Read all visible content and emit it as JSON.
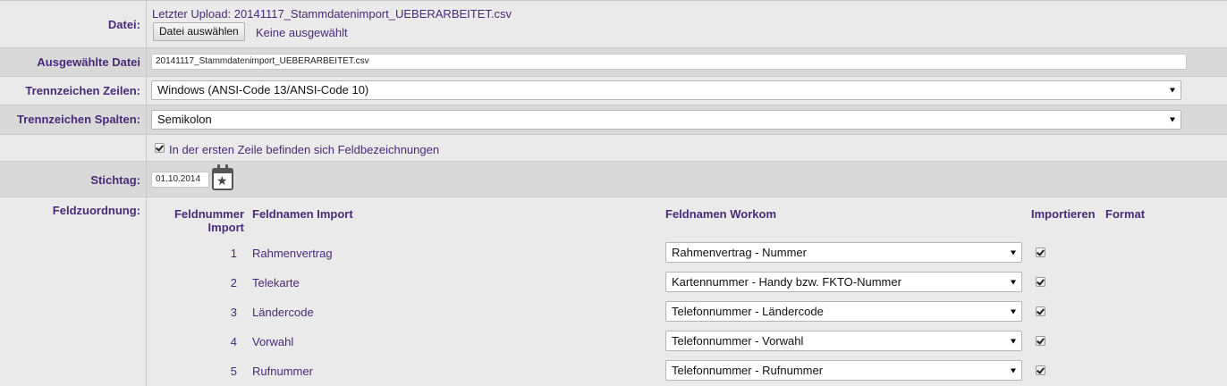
{
  "file": {
    "label": "Datei:",
    "last_upload": "Letzter Upload: 20141117_Stammdatenimport_UEBERARBEITET.csv",
    "button_label": "Datei auswählen",
    "no_file_text": "Keine ausgewählt"
  },
  "selected_file": {
    "label": "Ausgewählte Datei",
    "value": "20141117_Stammdatenimport_UEBERARBEITET.csv"
  },
  "row_delimiter": {
    "label": "Trennzeichen Zeilen:",
    "value": "Windows (ANSI-Code 13/ANSI-Code 10)"
  },
  "column_delimiter": {
    "label": "Trennzeichen Spalten:",
    "value": "Semikolon"
  },
  "header_row": {
    "checked": true,
    "label": "In der ersten Zeile befinden sich Feldbezeichnungen"
  },
  "key_date": {
    "label": "Stichtag:",
    "value": "01.10.2014",
    "calendar_icon": "calendar-star-icon"
  },
  "mapping": {
    "label": "Feldzuordnung:",
    "headers": {
      "number_line1": "Feldnummer",
      "number_line2": "Import",
      "import_name": "Feldnamen Import",
      "workom_name": "Feldnamen Workom",
      "import": "Importieren",
      "format": "Format"
    },
    "rows": [
      {
        "number": "1",
        "import_name": "Rahmenvertrag",
        "workom_name": "Rahmenvertrag - Nummer",
        "import": true
      },
      {
        "number": "2",
        "import_name": "Telekarte",
        "workom_name": "Kartennummer - Handy bzw. FKTO-Nummer",
        "import": true
      },
      {
        "number": "3",
        "import_name": "Ländercode",
        "workom_name": "Telefonnummer - Ländercode",
        "import": true
      },
      {
        "number": "4",
        "import_name": "Vorwahl",
        "workom_name": "Telefonnummer - Vorwahl",
        "import": true
      },
      {
        "number": "5",
        "import_name": "Rufnummer",
        "workom_name": "Telefonnummer - Rufnummer",
        "import": true
      }
    ]
  }
}
